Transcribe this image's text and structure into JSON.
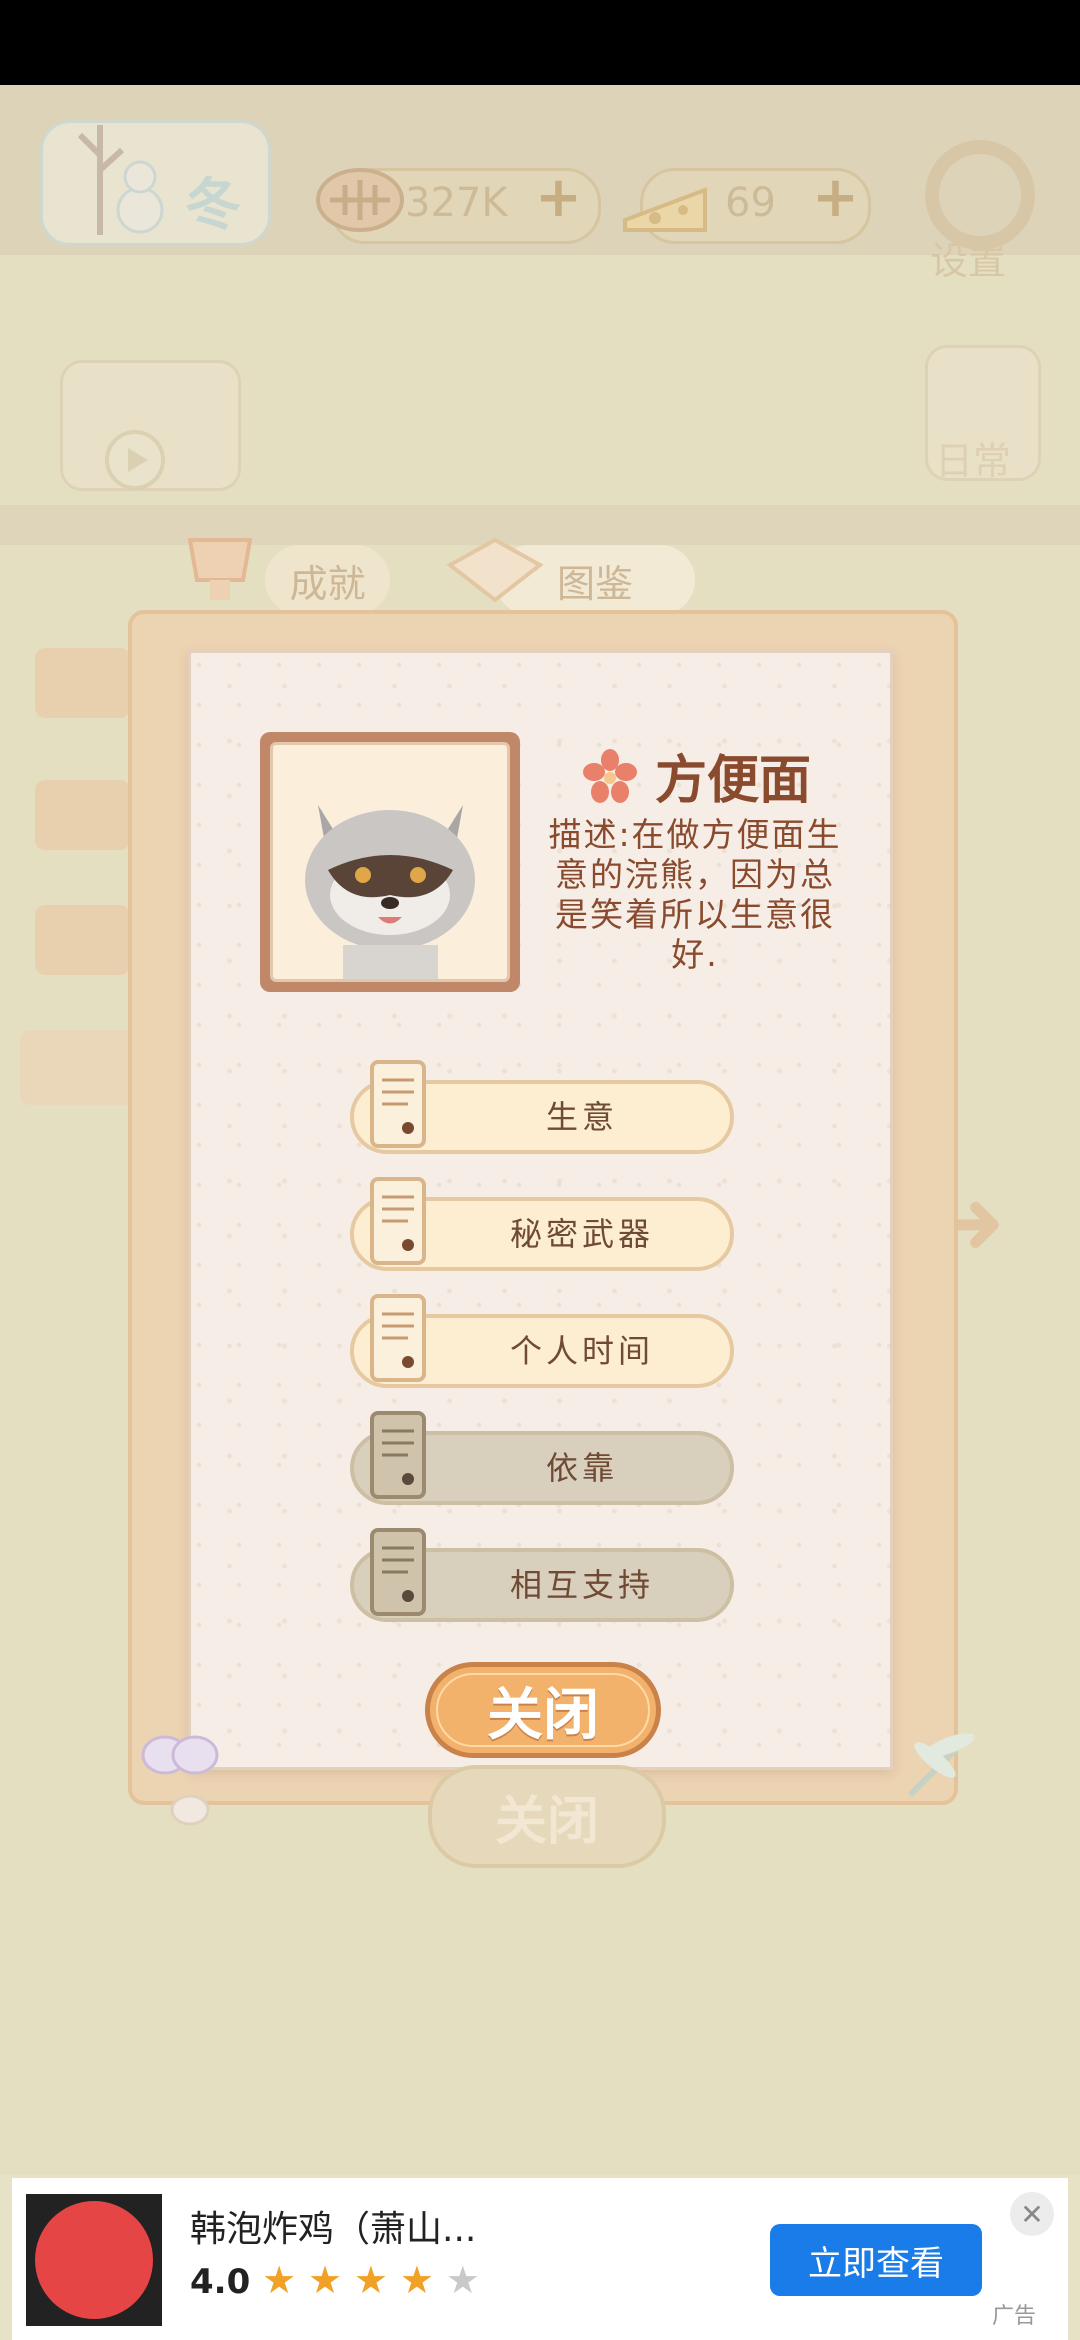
{
  "hud": {
    "season_label": "冬",
    "fish_value": "327K",
    "cheese_value": "69",
    "plus_symbol": "+",
    "settings_label": "设置",
    "daily_label": "日常"
  },
  "tabs": [
    {
      "label": "成就"
    },
    {
      "label": "图鉴"
    }
  ],
  "card": {
    "name": "方便面",
    "description": "描述:在做方便面生意的浣熊，因为总是笑着所以生意很好.",
    "stories": [
      {
        "label": "生意",
        "state": "unlocked"
      },
      {
        "label": "秘密武器",
        "state": "unlocked"
      },
      {
        "label": "个人时间",
        "state": "unlocked"
      },
      {
        "label": "依靠",
        "state": "locked"
      },
      {
        "label": "相互支持",
        "state": "locked"
      }
    ],
    "close_label": "关闭"
  },
  "background": {
    "ghost_close_label": "关闭"
  },
  "ad": {
    "title": "韩泡炸鸡（萧山...",
    "rating": "4.0",
    "stars_filled": 4,
    "stars_total": 5,
    "cta_label": "立即查看",
    "close_symbol": "✕",
    "tag": "广告"
  },
  "colors": {
    "accent_orange": "#f2b26b",
    "ad_button_blue": "#1a7ce8",
    "text_brown": "#8a4a2e"
  }
}
